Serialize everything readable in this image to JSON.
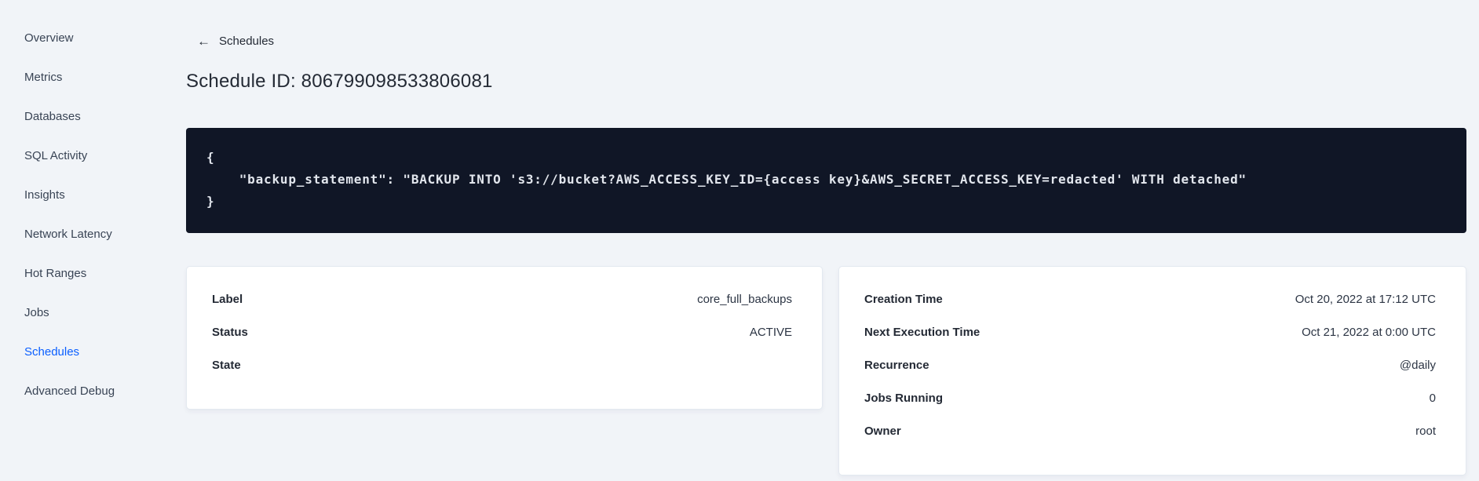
{
  "sidebar": {
    "items": [
      {
        "label": "Overview",
        "active": false
      },
      {
        "label": "Metrics",
        "active": false
      },
      {
        "label": "Databases",
        "active": false
      },
      {
        "label": "SQL Activity",
        "active": false
      },
      {
        "label": "Insights",
        "active": false
      },
      {
        "label": "Network Latency",
        "active": false
      },
      {
        "label": "Hot Ranges",
        "active": false
      },
      {
        "label": "Jobs",
        "active": false
      },
      {
        "label": "Schedules",
        "active": true
      },
      {
        "label": "Advanced Debug",
        "active": false
      }
    ],
    "active_color": "#0b5fff"
  },
  "header": {
    "back_icon": "←",
    "back_label": "Schedules",
    "title": "Schedule ID: 806799098533806081"
  },
  "code_block": {
    "background": "#101626",
    "lines": [
      {
        "text": "{"
      },
      {
        "text": "    \"backup_statement\": \"BACKUP INTO 's3://bucket?AWS_ACCESS_KEY_ID={access key}&AWS_SECRET_ACCESS_KEY=redacted' WITH detached\""
      },
      {
        "text": "}"
      }
    ]
  },
  "details_card": {
    "rows": [
      {
        "label": "Label",
        "value": "core_full_backups"
      },
      {
        "label": "Status",
        "value": "ACTIVE"
      },
      {
        "label": "State",
        "value": ""
      }
    ]
  },
  "schedule_card": {
    "rows": [
      {
        "label": "Creation Time",
        "value": "Oct 20, 2022 at 17:12 UTC"
      },
      {
        "label": "Next Execution Time",
        "value": "Oct 21, 2022 at 0:00 UTC"
      },
      {
        "label": "Recurrence",
        "value": "@daily"
      },
      {
        "label": "Jobs Running",
        "value": "0"
      },
      {
        "label": "Owner",
        "value": "root"
      }
    ]
  }
}
